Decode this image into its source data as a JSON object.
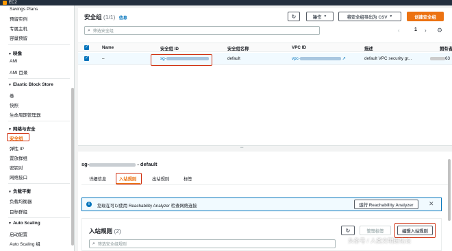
{
  "topbar": {
    "service": "EC2"
  },
  "sidebar": {
    "top_items": [
      "Savings Plans",
      "预留实例",
      "专属主机",
      "容量预留"
    ],
    "sections": [
      {
        "title": "映像",
        "items": [
          "AMI",
          "AMI 目录"
        ]
      },
      {
        "title": "Elastic Block Store",
        "items": [
          "卷",
          "快照",
          "生命周期管理器"
        ]
      },
      {
        "title": "网络与安全",
        "items": [
          "安全组",
          "弹性 IP",
          "置放群组",
          "密钥对",
          "网络接口"
        ]
      },
      {
        "title": "负载平衡",
        "items": [
          "负载均衡器",
          "目标群组"
        ]
      },
      {
        "title": "Auto Scaling",
        "items": [
          "启动配置",
          "Auto Scaling 组"
        ]
      }
    ]
  },
  "sg_panel": {
    "title": "安全组",
    "count": "(1/1)",
    "info_link": "信息",
    "refresh_icon": "refresh-icon",
    "actions_label": "操作",
    "export_label": "将安全组导出为 CSV",
    "create_label": "创建安全组",
    "search_placeholder": "筛选安全组",
    "page_number": "1",
    "columns": [
      "Name",
      "安全组 ID",
      "安全组名称",
      "VPC ID",
      "描述",
      "拥有者"
    ],
    "row": {
      "name": "–",
      "sg_id_prefix": "sg-",
      "group_name": "default",
      "vpc_prefix": "vpc-",
      "description": "default VPC security gr...",
      "owner_suffix": "63"
    }
  },
  "detail": {
    "header_prefix": "sg-",
    "header_suffix": "- default",
    "tabs": [
      "详细信息",
      "入站规则",
      "出站规则",
      "标签"
    ],
    "active_tab": "入站规则",
    "alert_text": "您现在可以使用 Reachability Analyzer 检查网络连接",
    "alert_button": "运行 Reachability Analyzer",
    "rules_title": "入站规则",
    "rules_count": "(2)",
    "manage_tags_label": "管理标签",
    "edit_rules_label": "编辑入站规则",
    "rules_search_placeholder": "筛选安全组规则"
  },
  "watermark": "头条号 / 人类文明进化论",
  "colors": {
    "accent": "#ec7211",
    "link": "#0073bb",
    "highlight": "#d13212"
  }
}
